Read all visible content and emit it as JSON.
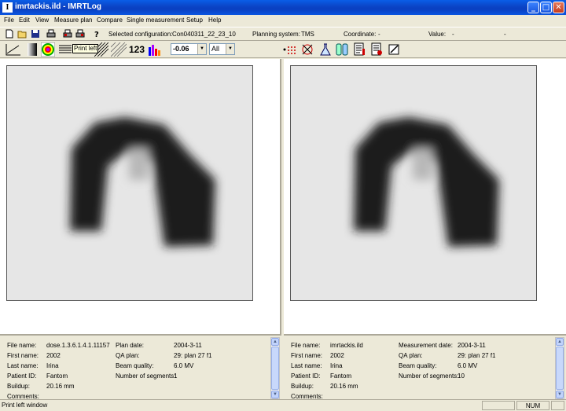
{
  "window": {
    "title": "imrtackis.ild - IMRTLog",
    "app_icon_letter": "I",
    "min_glyph": "_",
    "max_glyph": "□",
    "close_glyph": "✕"
  },
  "menu": [
    "File",
    "Edit",
    "View",
    "Measure plan",
    "Compare",
    "Single measurement",
    "Setup",
    "Help"
  ],
  "toolbar1": {
    "selected_configuration_label": "Selected configuration:",
    "selected_configuration_value": "Con040311_22_23_10",
    "planning_system_label": "Planning system:",
    "planning_system_value": "TMS",
    "coordinate_label": "Coordinate:",
    "coordinate_value": "-",
    "value_label": "Value:",
    "value_value": "-",
    "trailing_value": "-"
  },
  "toolbar2": {
    "numbers_label": "123",
    "threshold_value": "-0.06",
    "range_value": "All",
    "tooltip": "Print left"
  },
  "left_info": {
    "file_name_label": "File name:",
    "file_name": "dose.1.3.6.1.4.1.11157",
    "first_name_label": "First name:",
    "first_name": "2002",
    "last_name_label": "Last name:",
    "last_name": "Irina",
    "patient_id_label": "Patient ID:",
    "patient_id": "Fantom",
    "buildup_label": "Buildup:",
    "buildup": "20.16 mm",
    "comments_label": "Comments:",
    "date_label": "Plan date:",
    "date": "2004-3-11",
    "qa_plan_label": "QA plan:",
    "qa_plan": "29: plan 27 f1",
    "beam_quality_label": "Beam quality:",
    "beam_quality": "6.0 MV",
    "segments_label": "Number of segments:",
    "segments": "1"
  },
  "right_info": {
    "file_name_label": "File name:",
    "file_name": "imrtackis.ild",
    "first_name_label": "First name:",
    "first_name": "2002",
    "last_name_label": "Last name:",
    "last_name": "Irina",
    "patient_id_label": "Patient ID:",
    "patient_id": "Fantom",
    "buildup_label": "Buildup:",
    "buildup": "20.16 mm",
    "comments_label": "Comments:",
    "date_label": "Measurement date:",
    "date": "2004-3-11",
    "qa_plan_label": "QA plan:",
    "qa_plan": "29: plan 27 f1",
    "beam_quality_label": "Beam quality:",
    "beam_quality": "6.0 MV",
    "segments_label": "Number of segments:",
    "segments": "10"
  },
  "status": {
    "message": "Print left window",
    "num": "NUM"
  },
  "colors": {
    "titlebar": "#0a46c8",
    "chrome": "#ece9d8",
    "dose_dark": "#1a1a1a",
    "plot_bg": "#e6e6e6"
  }
}
